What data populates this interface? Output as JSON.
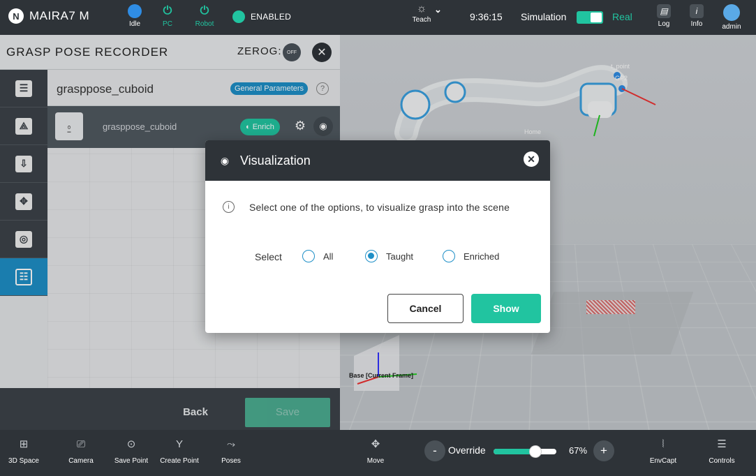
{
  "topbar": {
    "brand": "MAIRA7 M",
    "status_items": [
      {
        "label": "Idle",
        "icon": "status-dot-icon"
      },
      {
        "label": "PC",
        "icon": "power-icon"
      },
      {
        "label": "Robot",
        "icon": "power-icon"
      }
    ],
    "enabled_label": "ENABLED",
    "mode_label": "Teach",
    "time": "9:36:15",
    "simulation_label": "Simulation",
    "real_label": "Real",
    "log_label": "Log",
    "info_label": "Info",
    "user_label": "admin"
  },
  "panel": {
    "title": "GRASP POSE RECORDER",
    "zerog_label": "ZEROG:",
    "zerog_state": "OFF",
    "item_name": "grasppose_cuboid",
    "general_params_label": "General Parameters",
    "sub_item_name": "grasppose_cuboid",
    "enrich_label": "Enrich",
    "back_label": "Back",
    "save_label": "Save"
  },
  "scene": {
    "labels": [
      "t_point",
      "GP2",
      "Home",
      "Base [Current Frame]"
    ]
  },
  "modal": {
    "title": "Visualization",
    "message": "Select one of the options, to visualize grasp into the scene",
    "select_label": "Select",
    "options": [
      {
        "label": "All",
        "selected": false
      },
      {
        "label": "Taught",
        "selected": true
      },
      {
        "label": "Enriched",
        "selected": false
      }
    ],
    "cancel_label": "Cancel",
    "show_label": "Show"
  },
  "bottombar": {
    "tools": [
      {
        "label": "3D Space",
        "icon": "3d-space-icon"
      },
      {
        "label": "Camera",
        "icon": "camera-icon"
      },
      {
        "label": "Save Point",
        "icon": "save-point-icon"
      },
      {
        "label": "Create Point",
        "icon": "create-point-icon"
      },
      {
        "label": "Poses",
        "icon": "poses-icon"
      }
    ],
    "move_label": "Move",
    "override_label": "Override",
    "override_value": "67%",
    "override_fraction": 0.67,
    "envcapt_label": "EnvCapt",
    "controls_label": "Controls"
  },
  "colors": {
    "accent_green": "#21c4a0",
    "accent_blue": "#1e8fc7",
    "dark_bar": "#2e3338"
  }
}
